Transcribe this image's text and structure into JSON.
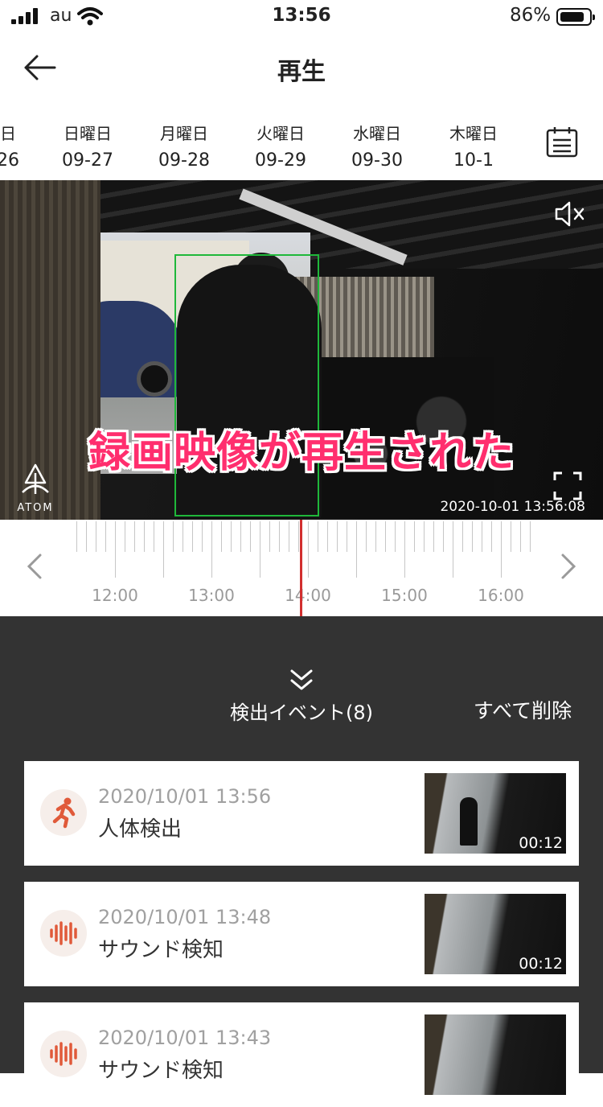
{
  "status_bar": {
    "carrier": "au",
    "time": "13:56",
    "battery": "86%",
    "battery_level": 0.86
  },
  "header": {
    "title": "再生"
  },
  "dates": [
    {
      "weekday": "日",
      "date": "26"
    },
    {
      "weekday": "日曜日",
      "date": "09-27"
    },
    {
      "weekday": "月曜日",
      "date": "09-28"
    },
    {
      "weekday": "火曜日",
      "date": "09-29"
    },
    {
      "weekday": "水曜日",
      "date": "09-30"
    },
    {
      "weekday": "木曜日",
      "date": "10-1"
    }
  ],
  "video": {
    "overlay_caption": "録画映像が再生された",
    "logo_text": "ATOM",
    "timestamp": "2020-10-01  13:56:08"
  },
  "timeline": {
    "labels": [
      "12:00",
      "13:00",
      "14:00",
      "15:00",
      "16:00"
    ]
  },
  "events": {
    "title": "検出イベント(8)",
    "delete_all": "すべて削除",
    "items": [
      {
        "timestamp": "2020/10/01 13:56",
        "type": "人体検出",
        "icon": "running-person-icon",
        "duration": "00:12"
      },
      {
        "timestamp": "2020/10/01 13:48",
        "type": "サウンド検知",
        "icon": "sound-wave-icon",
        "duration": "00:12"
      },
      {
        "timestamp": "2020/10/01 13:43",
        "type": "サウンド検知",
        "icon": "sound-wave-icon",
        "duration": ""
      }
    ]
  },
  "colors": {
    "accent": "#d22f2f",
    "icon": "#e05a3a",
    "panel": "#333333",
    "overlay": "#ff2e6e",
    "detect_box": "#1fb83a"
  }
}
